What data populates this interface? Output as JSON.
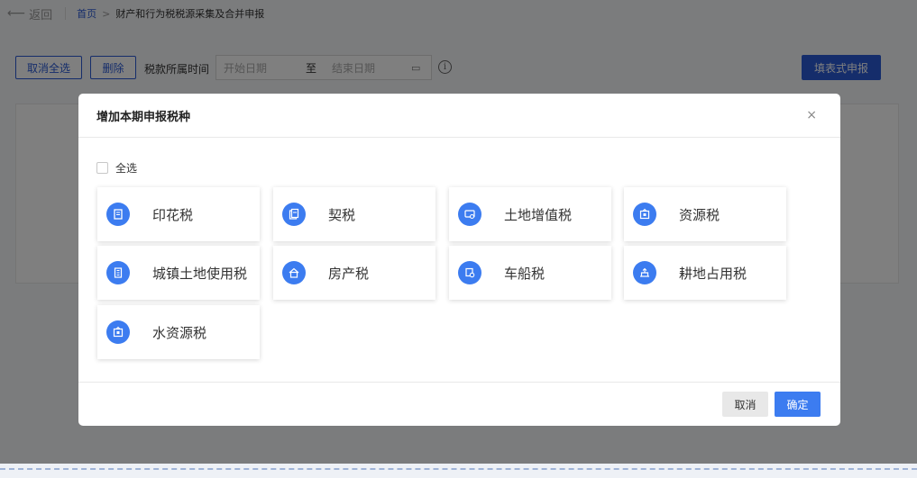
{
  "page": {
    "back_label": "返回",
    "breadcrumb": {
      "home": "首页",
      "separator": ">",
      "current": "财产和行为税税源采集及合并申报"
    },
    "toolbar": {
      "cancel_all_label": "取消全选",
      "delete_label": "删除",
      "period_label": "税款所属时间",
      "start_placeholder": "开始日期",
      "range_separator": "至",
      "end_placeholder": "结束日期",
      "fill_report_label": "填表式申报"
    }
  },
  "dialog": {
    "title": "增加本期申报税种",
    "close_glyph": "×",
    "select_all_label": "全选",
    "select_all_checked": false,
    "tax_types": [
      {
        "label": "印花税",
        "icon": "document-icon"
      },
      {
        "label": "契税",
        "icon": "contract-icon"
      },
      {
        "label": "土地增值税",
        "icon": "land-icon"
      },
      {
        "label": "资源税",
        "icon": "box-icon"
      },
      {
        "label": "城镇土地使用税",
        "icon": "building-icon"
      },
      {
        "label": "房产税",
        "icon": "house-icon"
      },
      {
        "label": "车船税",
        "icon": "vehicle-icon"
      },
      {
        "label": "耕地占用税",
        "icon": "farmland-icon"
      },
      {
        "label": "水资源税",
        "icon": "water-icon"
      }
    ],
    "footer": {
      "cancel_label": "取消",
      "ok_label": "确定"
    }
  },
  "colors": {
    "primary": "#2a5ad6",
    "icon_blue": "#3c7cf0",
    "overlay": "rgba(0,0,0,0.5)"
  }
}
